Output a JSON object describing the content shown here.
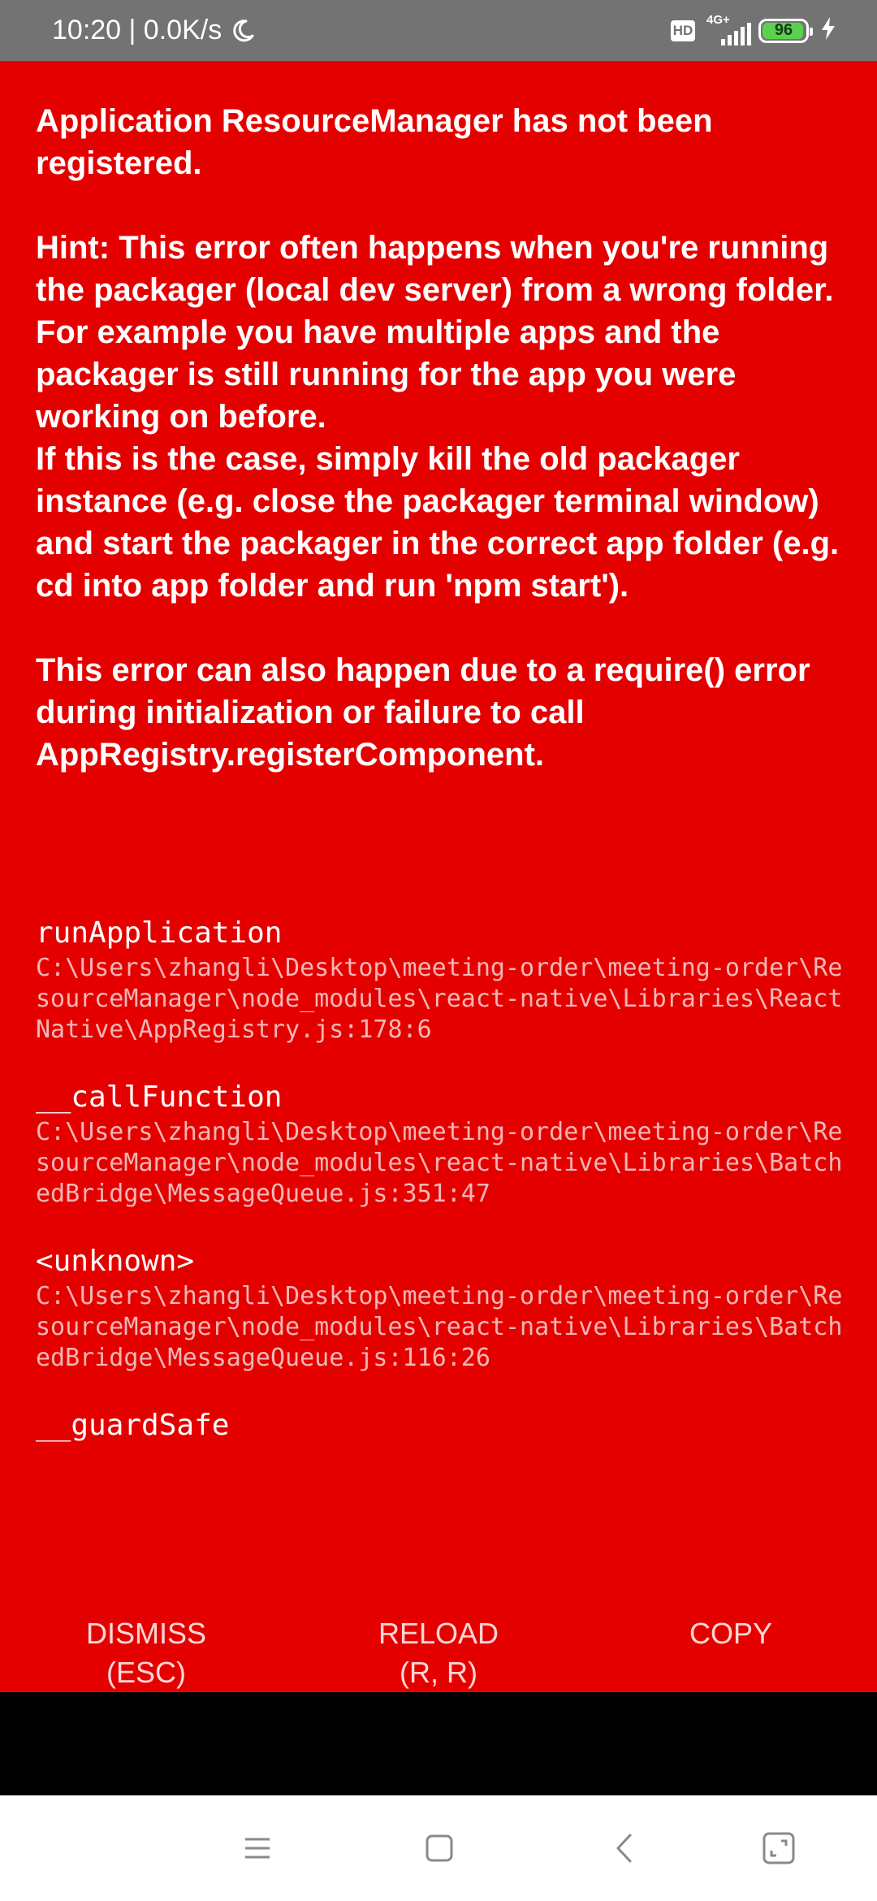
{
  "status_bar": {
    "time_speed": "10:20 | 0.0K/s",
    "hd_label": "HD",
    "network_label": "4G+",
    "battery_level": "96",
    "moon_icon": "moon-icon",
    "signal_icon": "signal-bars-icon",
    "charging_icon": "lightning-icon"
  },
  "error": {
    "title": "Application ResourceManager has not been registered.",
    "hint": "Hint: This error often happens when you're running the packager (local dev server) from a wrong folder. For example you have multiple apps and the packager is still running for the app you were working on before.\nIf this is the case, simply kill the old packager instance (e.g. close the packager terminal window) and start the packager in the correct app folder (e.g. cd into app folder and run 'npm start').",
    "extra": "This error can also happen due to a require() error during initialization or failure to call AppRegistry.registerComponent."
  },
  "stack": [
    {
      "function": "runApplication",
      "file": "C:\\Users\\zhangli\\Desktop\\meeting-order\\meeting-order\\ResourceManager\\node_modules\\react-native\\Libraries\\ReactNative\\AppRegistry.js:178:6"
    },
    {
      "function": "__callFunction",
      "file": "C:\\Users\\zhangli\\Desktop\\meeting-order\\meeting-order\\ResourceManager\\node_modules\\react-native\\Libraries\\BatchedBridge\\MessageQueue.js:351:47"
    },
    {
      "function": "<unknown>",
      "file": "C:\\Users\\zhangli\\Desktop\\meeting-order\\meeting-order\\ResourceManager\\node_modules\\react-native\\Libraries\\BatchedBridge\\MessageQueue.js:116:26"
    },
    {
      "function": "__guardSafe",
      "file": ""
    }
  ],
  "buttons": {
    "dismiss_line1": "DISMISS",
    "dismiss_line2": "(ESC)",
    "reload_line1": "RELOAD",
    "reload_line2": "(R, R)",
    "copy_label": "COPY"
  },
  "nav_bar": {
    "menu_icon": "menu-icon",
    "home_icon": "home-square-icon",
    "back_icon": "back-chevron-icon",
    "screenshot_icon": "expand-corner-icon"
  },
  "colors": {
    "error_background": "#e50000",
    "status_bar": "#737373",
    "stack_file_text": "#f3b6b6",
    "battery_fill": "#5bd14d"
  }
}
